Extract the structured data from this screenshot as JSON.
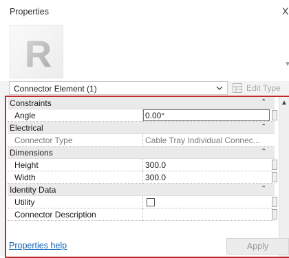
{
  "panel": {
    "title": "Properties",
    "close_glyph": "X"
  },
  "type_image": {
    "letter": "R",
    "icon": "revit-family-icon"
  },
  "selector": {
    "selected_value": "Connector Element (1)",
    "edit_type_label": "Edit Type"
  },
  "groups": [
    {
      "label": "Constraints",
      "rows": [
        {
          "name": "Angle",
          "value": "0.00°",
          "editing": true,
          "enabled": true
        }
      ]
    },
    {
      "label": "Electrical",
      "rows": [
        {
          "name": "Connector Type",
          "value": "Cable Tray Individual Connec...",
          "editing": false,
          "enabled": false
        }
      ]
    },
    {
      "label": "Dimensions",
      "rows": [
        {
          "name": "Height",
          "value": "300.0",
          "editing": false,
          "enabled": true
        },
        {
          "name": "Width",
          "value": "300.0",
          "editing": false,
          "enabled": true
        }
      ]
    },
    {
      "label": "Identity Data",
      "rows": [
        {
          "name": "Utility",
          "value": "",
          "checkbox": true,
          "checked": false,
          "enabled": true
        },
        {
          "name": "Connector Description",
          "value": "",
          "editing": false,
          "enabled": true
        }
      ]
    }
  ],
  "footer": {
    "help_link": "Properties help",
    "apply_label": "Apply"
  },
  "colors": {
    "highlight_border": "#c0282d",
    "link": "#0b5fb5",
    "group_background": "#eaeaea",
    "disabled_text": "#9b9b9b"
  }
}
